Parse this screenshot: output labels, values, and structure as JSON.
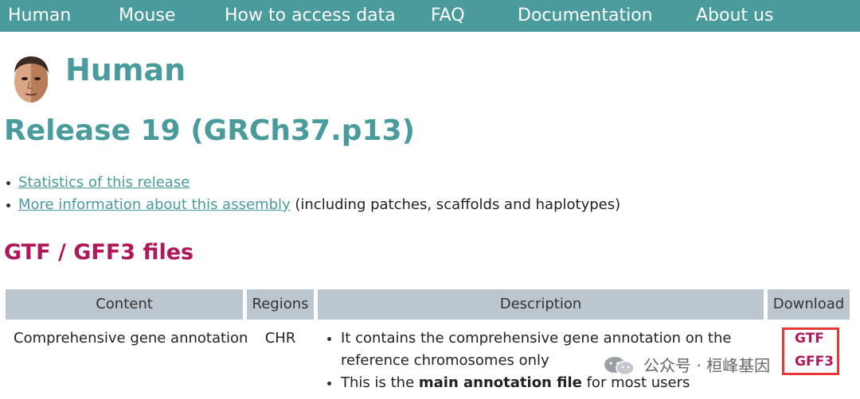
{
  "nav": {
    "items": [
      "Human",
      "Mouse",
      "How to access data",
      "FAQ",
      "Documentation",
      "About us"
    ]
  },
  "header": {
    "species": "Human",
    "release": "Release 19 (GRCh37.p13)"
  },
  "links": {
    "stats": "Statistics of this release",
    "assembly": "More information about this assembly",
    "assembly_suffix": " (including patches, scaffolds and haplotypes)"
  },
  "section": {
    "title": "GTF / GFF3 files"
  },
  "table": {
    "headers": [
      "Content",
      "Regions",
      "Description",
      "Download"
    ],
    "rows": [
      {
        "content": "Comprehensive gene annotation",
        "regions": "CHR",
        "description": [
          "It contains the comprehensive gene annotation on the reference chromosomes only",
          {
            "before": "This is the ",
            "bold": "main annotation file",
            "after": " for most users"
          }
        ],
        "downloads": [
          "GTF",
          "GFF3"
        ]
      }
    ]
  },
  "watermark": {
    "text": "公众号 · 桓峰基因"
  },
  "colors": {
    "teal": "#4a9b9b",
    "magenta": "#b0185a",
    "header_gray": "#bcc6cf",
    "highlight_red": "#e53935"
  }
}
